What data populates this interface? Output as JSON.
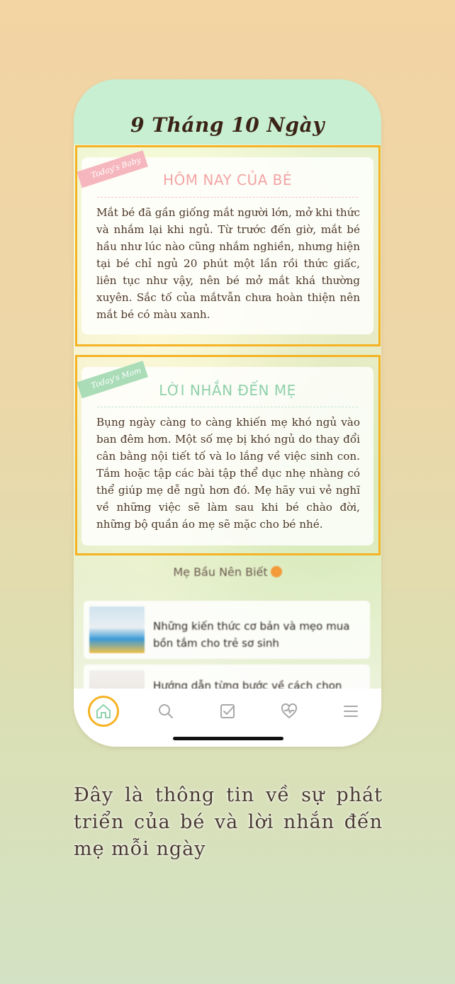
{
  "phone": {
    "title": "9 Tháng 10 Ngày"
  },
  "today_baby": {
    "ribbon": "Today's Baby",
    "title": "HÔM NAY CỦA BÉ",
    "body": "Mắt bé đã gần giống mắt người lớn, mở khi thức và nhắm lại khi ngủ. Từ trước đến giờ, mắt bé hầu như lúc nào cũng nhắm nghiền, nhưng hiện tại bé chỉ ngủ 20 phút một lần rồi thức giấc, liên tục như vậy, nên bé mở mắt khá thường xuyên. Sắc tố của mắtvẫn chưa hoàn thiện nên mắt bé có màu xanh."
  },
  "today_mom": {
    "ribbon": "Today's Mom",
    "title": "LỜI NHẮN ĐẾN MẸ",
    "body": "Bụng ngày càng to càng khiến mẹ khó ngủ vào ban đêm hơn. Một số mẹ bị khó ngủ do thay đổi cân bằng nội tiết tố và lo lắng về việc sinh con. Tắm hoặc tập các bài tập thể dục nhẹ nhàng có thể giúp mẹ dễ ngủ hơn đó. Mẹ hãy vui vẻ nghĩ về những việc sẽ làm sau khi bé chào đời, những bộ quần áo mẹ sẽ mặc cho bé nhé."
  },
  "section": {
    "label": "Mẹ Bầu Nên Biết"
  },
  "articles": [
    {
      "title": "Những kiến thức cơ bản và mẹo mua bồn tắm cho trẻ sơ sinh"
    },
    {
      "title": "Hướng dẫn từng bước về cách chọn"
    }
  ],
  "tabbar": {
    "icons": [
      "home-icon",
      "search-icon",
      "checklist-icon",
      "heart-pulse-icon",
      "menu-icon"
    ]
  },
  "caption": "Đây là thông tin về sự phát triển của bé và lời nhắn đến mẹ mỗi ngày",
  "colors": {
    "highlight": "#f5b324",
    "baby_title": "#f2a4a4",
    "mom_title": "#8fd1ab",
    "header": "#c8efd2"
  }
}
